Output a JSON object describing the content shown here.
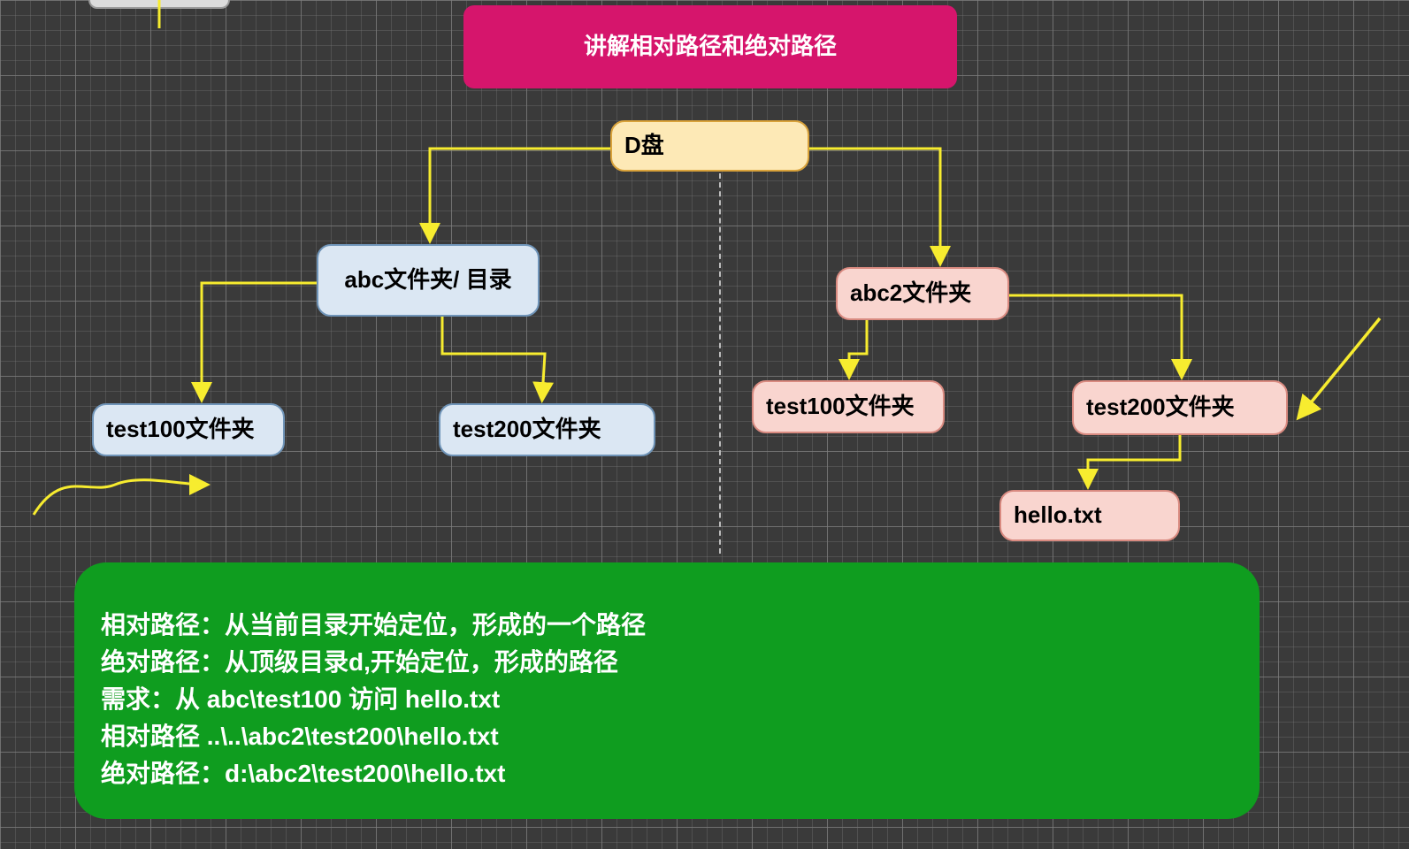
{
  "title": "讲解相对路径和绝对路径",
  "nodes": {
    "root": "D盘",
    "abc": "abc文件夹/ 目录",
    "abc2": "abc2文件夹",
    "test100_left": "test100文件夹",
    "test200_left": "test200文件夹",
    "test100_right": "test100文件夹",
    "test200_right": "test200文件夹",
    "hello": "hello.txt"
  },
  "panel": {
    "line1": "相对路径：从当前目录开始定位，形成的一个路径",
    "line2": "绝对路径：从顶级目录d,开始定位，形成的路径",
    "line3": "需求：从 abc\\test100 访问 hello.txt",
    "line4": "相对路径  ..\\..\\abc2\\test200\\hello.txt",
    "line5": "绝对路径：d:\\abc2\\test200\\hello.txt"
  },
  "colors": {
    "arrow": "#f7ec2f",
    "title_bg": "#d6156c",
    "panel_bg": "#0f9d1f",
    "cream": "#fde9b6",
    "blue": "#dbe7f3",
    "pink": "#f9d5cf"
  }
}
